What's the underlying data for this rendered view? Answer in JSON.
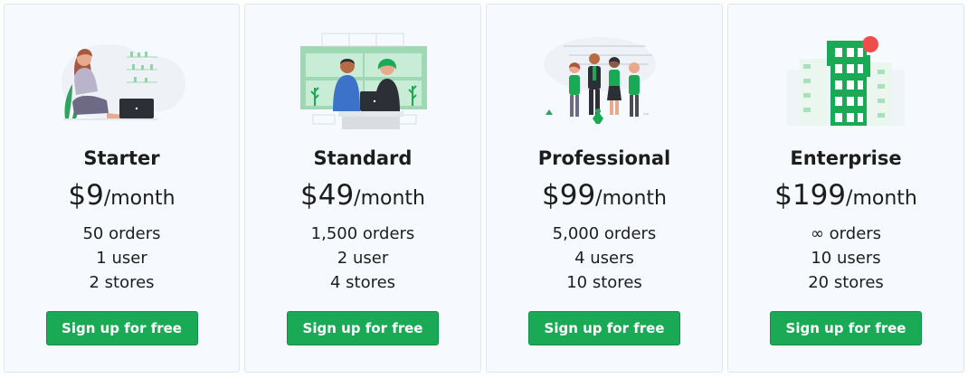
{
  "colors": {
    "accent": "#1aaa55",
    "card_background": "#f6faff",
    "card_border": "#dde5ee",
    "text": "#1d1d1d"
  },
  "plans": [
    {
      "illustration": "woman-with-laptop",
      "name": "Starter",
      "price": "$9",
      "period": "/month",
      "features": [
        "50 orders",
        "1 user",
        "2 stores"
      ],
      "cta_label": "Sign up for free"
    },
    {
      "illustration": "two-people-at-desk",
      "name": "Standard",
      "price": "$49",
      "period": "/month",
      "features": [
        "1,500 orders",
        "2 user",
        "4 stores"
      ],
      "cta_label": "Sign up for free"
    },
    {
      "illustration": "team-of-four",
      "name": "Professional",
      "price": "$99",
      "period": "/month",
      "features": [
        "5,000 orders",
        "4 users",
        "10 stores"
      ],
      "cta_label": "Sign up for free"
    },
    {
      "illustration": "office-building",
      "name": "Enterprise",
      "price": "$199",
      "period": "/month",
      "features": [
        "∞ orders",
        "10 users",
        "20 stores"
      ],
      "cta_label": "Sign up for free"
    }
  ]
}
